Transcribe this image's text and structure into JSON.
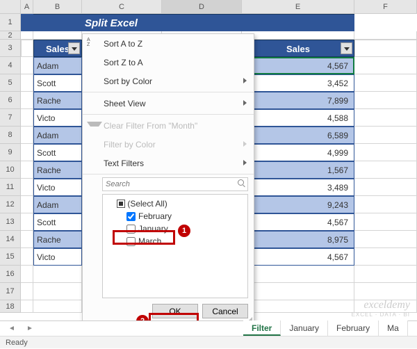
{
  "title_banner": "Split Excel Sheet into Multiple Worksheets",
  "columns": [
    "A",
    "B",
    "C",
    "D",
    "E",
    "F"
  ],
  "header": {
    "salesman": "Sales",
    "sales": "Sales"
  },
  "rows": [
    {
      "num": "1"
    },
    {
      "num": "2"
    },
    {
      "num": "3",
      "salesman": "Sale",
      "sales_curr": "",
      "sales_val": ""
    },
    {
      "num": "4",
      "salesman": "Adam",
      "sales_curr": "$",
      "sales_val": "4,567"
    },
    {
      "num": "5",
      "salesman": "Scott",
      "sales_curr": "$",
      "sales_val": "3,452"
    },
    {
      "num": "6",
      "salesman": "Rache",
      "sales_curr": "$",
      "sales_val": "7,899"
    },
    {
      "num": "7",
      "salesman": "Victo",
      "sales_curr": "$",
      "sales_val": "4,588"
    },
    {
      "num": "8",
      "salesman": "Adam",
      "sales_curr": "$",
      "sales_val": "6,589"
    },
    {
      "num": "9",
      "salesman": "Scott",
      "sales_curr": "$",
      "sales_val": "4,999"
    },
    {
      "num": "10",
      "salesman": "Rache",
      "sales_curr": "$",
      "sales_val": "1,567"
    },
    {
      "num": "11",
      "salesman": "Victo",
      "sales_curr": "$",
      "sales_val": "3,489"
    },
    {
      "num": "12",
      "salesman": "Adam",
      "sales_curr": "$",
      "sales_val": "9,243"
    },
    {
      "num": "13",
      "salesman": "Scott",
      "sales_curr": "$",
      "sales_val": "4,567"
    },
    {
      "num": "14",
      "salesman": "Rache",
      "sales_curr": "$",
      "sales_val": "8,975"
    },
    {
      "num": "15",
      "salesman": "Victo",
      "sales_curr": "$",
      "sales_val": "4,567"
    },
    {
      "num": "16"
    },
    {
      "num": "17"
    },
    {
      "num": "18"
    }
  ],
  "menu": {
    "sort_az": "Sort A to Z",
    "sort_za": "Sort Z to A",
    "sort_color": "Sort by Color",
    "sheet_view": "Sheet View",
    "clear_filter": "Clear Filter From \"Month\"",
    "filter_color": "Filter by Color",
    "text_filters": "Text Filters",
    "search_placeholder": "Search",
    "filter_items": {
      "select_all": "(Select All)",
      "february": "February",
      "january": "January",
      "march": "March"
    },
    "ok": "OK",
    "cancel": "Cancel"
  },
  "badges": {
    "one": "1",
    "two": "2"
  },
  "tabs": {
    "filter": "Filter",
    "january": "January",
    "february": "February",
    "march": "Ma"
  },
  "status": {
    "ready": "Ready"
  },
  "watermark": {
    "line1": "exceldemy",
    "line2": "EXCEL · DATA · BI"
  }
}
